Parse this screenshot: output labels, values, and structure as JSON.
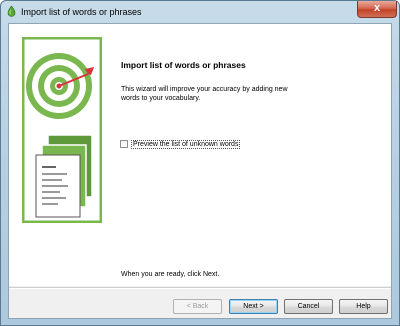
{
  "window": {
    "title": "Import list of words or phrases",
    "close_glyph": "x"
  },
  "wizard": {
    "heading": "Import list of words or phrases",
    "description": "This wizard will improve your accuracy by adding new words to your vocabulary.",
    "checkbox": {
      "label": "Preview the list of unknown words",
      "checked": false
    },
    "footer_text": "When you are ready, click Next."
  },
  "buttons": {
    "back": "< Back",
    "next": "Next >",
    "cancel": "Cancel",
    "help": "Help"
  },
  "colors": {
    "accent_green": "#7ab84f",
    "dart_red": "#d8323b"
  },
  "icons": [
    "app-icon",
    "target-icon",
    "documents-icon",
    "close-icon"
  ]
}
